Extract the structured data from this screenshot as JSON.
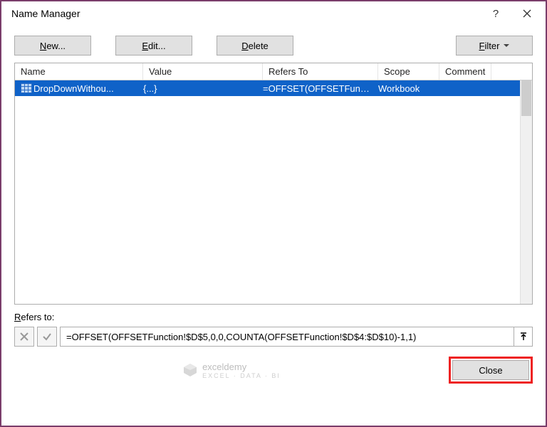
{
  "dialog": {
    "title": "Name Manager"
  },
  "buttons": {
    "new_pre": "",
    "new_accel": "N",
    "new_post": "ew...",
    "edit_pre": "",
    "edit_accel": "E",
    "edit_post": "dit...",
    "delete_pre": "",
    "delete_accel": "D",
    "delete_post": "elete",
    "filter_pre": "",
    "filter_accel": "F",
    "filter_post": "ilter",
    "close": "Close"
  },
  "columns": {
    "name": "Name",
    "value": "Value",
    "refers": "Refers To",
    "scope": "Scope",
    "comment": "Comment"
  },
  "rows": [
    {
      "name": "DropDownWithou...",
      "value": "{...}",
      "refers": "=OFFSET(OFFSETFunc...",
      "scope": "Workbook",
      "comment": ""
    }
  ],
  "refers_label_pre": "",
  "refers_label_accel": "R",
  "refers_label_post": "efers to:",
  "formula": "=OFFSET(OFFSETFunction!$D$5,0,0,COUNTA(OFFSETFunction!$D$4:$D$10)-1,1)",
  "watermark": {
    "brand": "exceldemy",
    "tag": "EXCEL · DATA · BI"
  }
}
